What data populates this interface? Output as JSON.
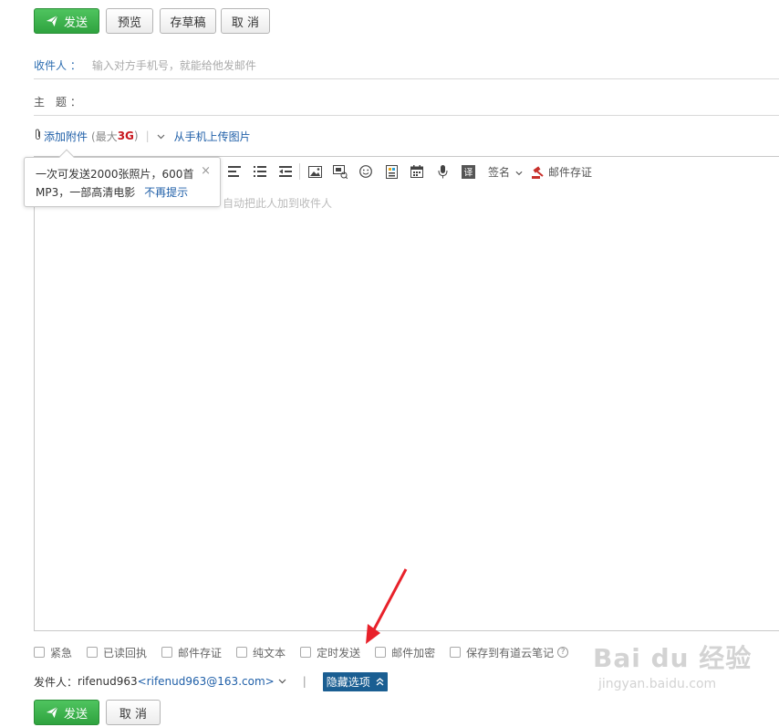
{
  "toolbar_top": {
    "send": "发送",
    "preview": "预览",
    "draft": "存草稿",
    "cancel": "取 消"
  },
  "recipient": {
    "label": "收件人 ：",
    "placeholder": "输入对方手机号，就能给他发邮件"
  },
  "subject": {
    "label": "主　题 ："
  },
  "attachment": {
    "add": "添加附件",
    "max_prefix": "(最大",
    "max_value": "3G",
    "max_suffix": ")",
    "upload_phone": "从手机上传图片"
  },
  "tooltip": {
    "line1": "一次可发送2000张照片，600首",
    "line2": "MP3，一部高清电影",
    "dismiss": "不再提示",
    "close": "×"
  },
  "editor_toolbar": {
    "signature": "签名",
    "save_cert": "邮件存证"
  },
  "editor": {
    "placeholder": "自动把此人加到收件人"
  },
  "options": {
    "urgent": "紧急",
    "read_receipt": "已读回执",
    "mail_cert": "邮件存证",
    "plain_text": "纯文本",
    "scheduled": "定时发送",
    "encrypt": "邮件加密",
    "youdao": "保存到有道云笔记",
    "help": "?"
  },
  "sender": {
    "label": "发件人：",
    "name": "rifenud963",
    "email": "<rifenud963@163.com>",
    "sep": "|",
    "hide_options": "隐藏选项"
  },
  "toolbar_bottom": {
    "send": "发送",
    "cancel": "取 消"
  },
  "watermark": {
    "main": "Bai du 经验",
    "sub": "jingyan.baidu.com"
  },
  "colors": {
    "send_green": "#34a845",
    "link_blue": "#1f5fa8",
    "hide_badge": "#1a5e92",
    "annotation_red": "#e8212a"
  }
}
